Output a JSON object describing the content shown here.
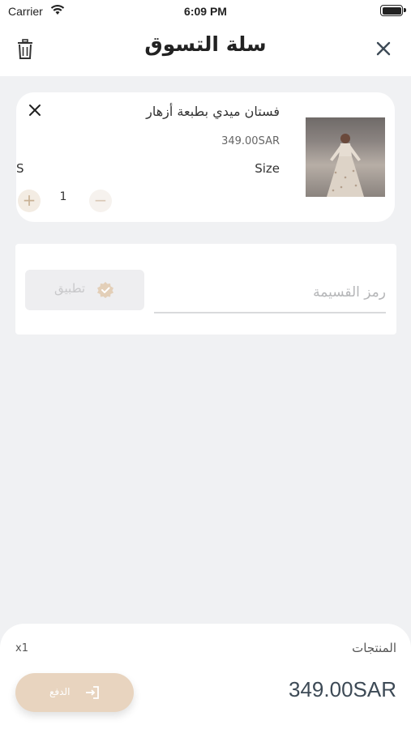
{
  "status_bar": {
    "carrier": "Carrier",
    "time": "6:09 PM"
  },
  "nav": {
    "title": "سلة التسوق",
    "trash_icon": "trash-icon",
    "close_icon": "close-icon"
  },
  "cart_item": {
    "name": "فستان ميدي بطبعة أزهار",
    "price": "349.00SAR",
    "size_label": "Size",
    "size_value": "S",
    "quantity": "1",
    "plus": "+",
    "minus": "−"
  },
  "coupon": {
    "placeholder": "رمز القسيمة",
    "value": "",
    "apply_label": "تطبيق"
  },
  "summary": {
    "items_label": "المنتجات",
    "items_count": "x1",
    "total": "349.00SAR",
    "checkout_label": "الدفع"
  },
  "colors": {
    "accent": "#e8d4bf",
    "background": "#f0f1f3",
    "total_text": "#3d4a56"
  }
}
